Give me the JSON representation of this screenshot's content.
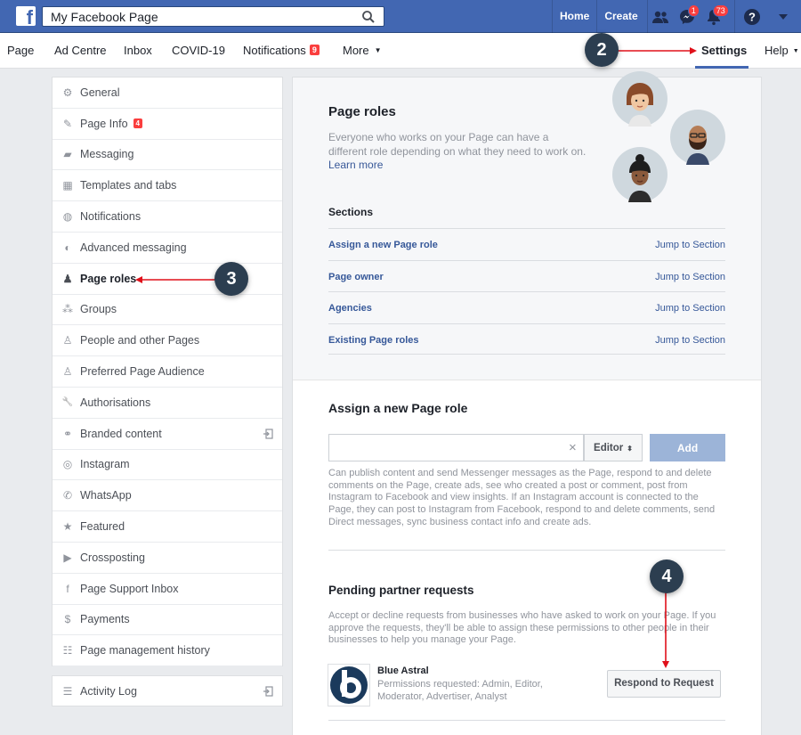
{
  "topbar": {
    "logo": "f",
    "search_value": "My Facebook Page",
    "search_icon": "search-icon",
    "home": "Home",
    "create": "Create",
    "messenger_badge": "1",
    "notifications_badge": "73",
    "help_icon": "question-icon"
  },
  "subnav": {
    "page": "Page",
    "ad_centre": "Ad Centre",
    "inbox": "Inbox",
    "covid": "COVID-19",
    "notifications": "Notifications",
    "notifications_count": "9",
    "more": "More",
    "settings": "Settings",
    "help": "Help"
  },
  "steps": {
    "two": "2",
    "three": "3",
    "four": "4"
  },
  "sidebar": {
    "items": [
      {
        "label": "General",
        "icon": "gear-icon"
      },
      {
        "label": "Page Info",
        "icon": "pencil-icon",
        "badge": "4"
      },
      {
        "label": "Messaging",
        "icon": "chat-icon"
      },
      {
        "label": "Templates and tabs",
        "icon": "grid-icon"
      },
      {
        "label": "Notifications",
        "icon": "globe-icon"
      },
      {
        "label": "Advanced messaging",
        "icon": "messenger-icon"
      },
      {
        "label": "Page roles",
        "icon": "person-icon"
      },
      {
        "label": "Groups",
        "icon": "group-icon"
      },
      {
        "label": "People and other Pages",
        "icon": "people-icon"
      },
      {
        "label": "Preferred Page Audience",
        "icon": "audience-icon"
      },
      {
        "label": "Authorisations",
        "icon": "wrench-icon"
      },
      {
        "label": "Branded content",
        "icon": "handshake-icon"
      },
      {
        "label": "Instagram",
        "icon": "instagram-icon"
      },
      {
        "label": "WhatsApp",
        "icon": "whatsapp-icon"
      },
      {
        "label": "Featured",
        "icon": "star-icon"
      },
      {
        "label": "Crossposting",
        "icon": "video-icon"
      },
      {
        "label": "Page Support Inbox",
        "icon": "facebook-icon"
      },
      {
        "label": "Payments",
        "icon": "dollar-icon"
      },
      {
        "label": "Page management history",
        "icon": "history-icon"
      }
    ],
    "activity_log": "Activity Log"
  },
  "roles": {
    "title": "Page roles",
    "description": "Everyone who works on your Page can have a different role depending on what they need to work on.",
    "learn_more": "Learn more",
    "sections_title": "Sections",
    "sections": [
      {
        "name": "Assign a new Page role",
        "jump": "Jump to Section"
      },
      {
        "name": "Page owner",
        "jump": "Jump to Section"
      },
      {
        "name": "Agencies",
        "jump": "Jump to Section"
      },
      {
        "name": "Existing Page roles",
        "jump": "Jump to Section"
      }
    ]
  },
  "assign": {
    "title": "Assign a new Page role",
    "input_value": "",
    "clear": "×",
    "role": "Editor",
    "add": "Add",
    "help": "Can publish content and send Messenger messages as the Page, respond to and delete comments on the Page, create ads, see who created a post or comment, post from Instagram to Facebook and view insights. If an Instagram account is connected to the Page, they can post to Instagram from Facebook, respond to and delete comments, send Direct messages, sync business contact info and create ads."
  },
  "pending": {
    "title": "Pending partner requests",
    "help": "Accept or decline requests from businesses who have asked to work on your Page. If you approve the requests, they'll be able to assign these permissions to other people in their businesses to help you manage your Page.",
    "partner_name": "Blue Astral",
    "permissions": "Permissions requested: Admin, Editor, Moderator, Advertiser, Analyst",
    "respond": "Respond to Request"
  },
  "colors": {
    "brand": "#4267b2",
    "badge": "#fa3e3e",
    "annotation_arrow": "#e0101a",
    "step_marker": "#2c3e50"
  }
}
